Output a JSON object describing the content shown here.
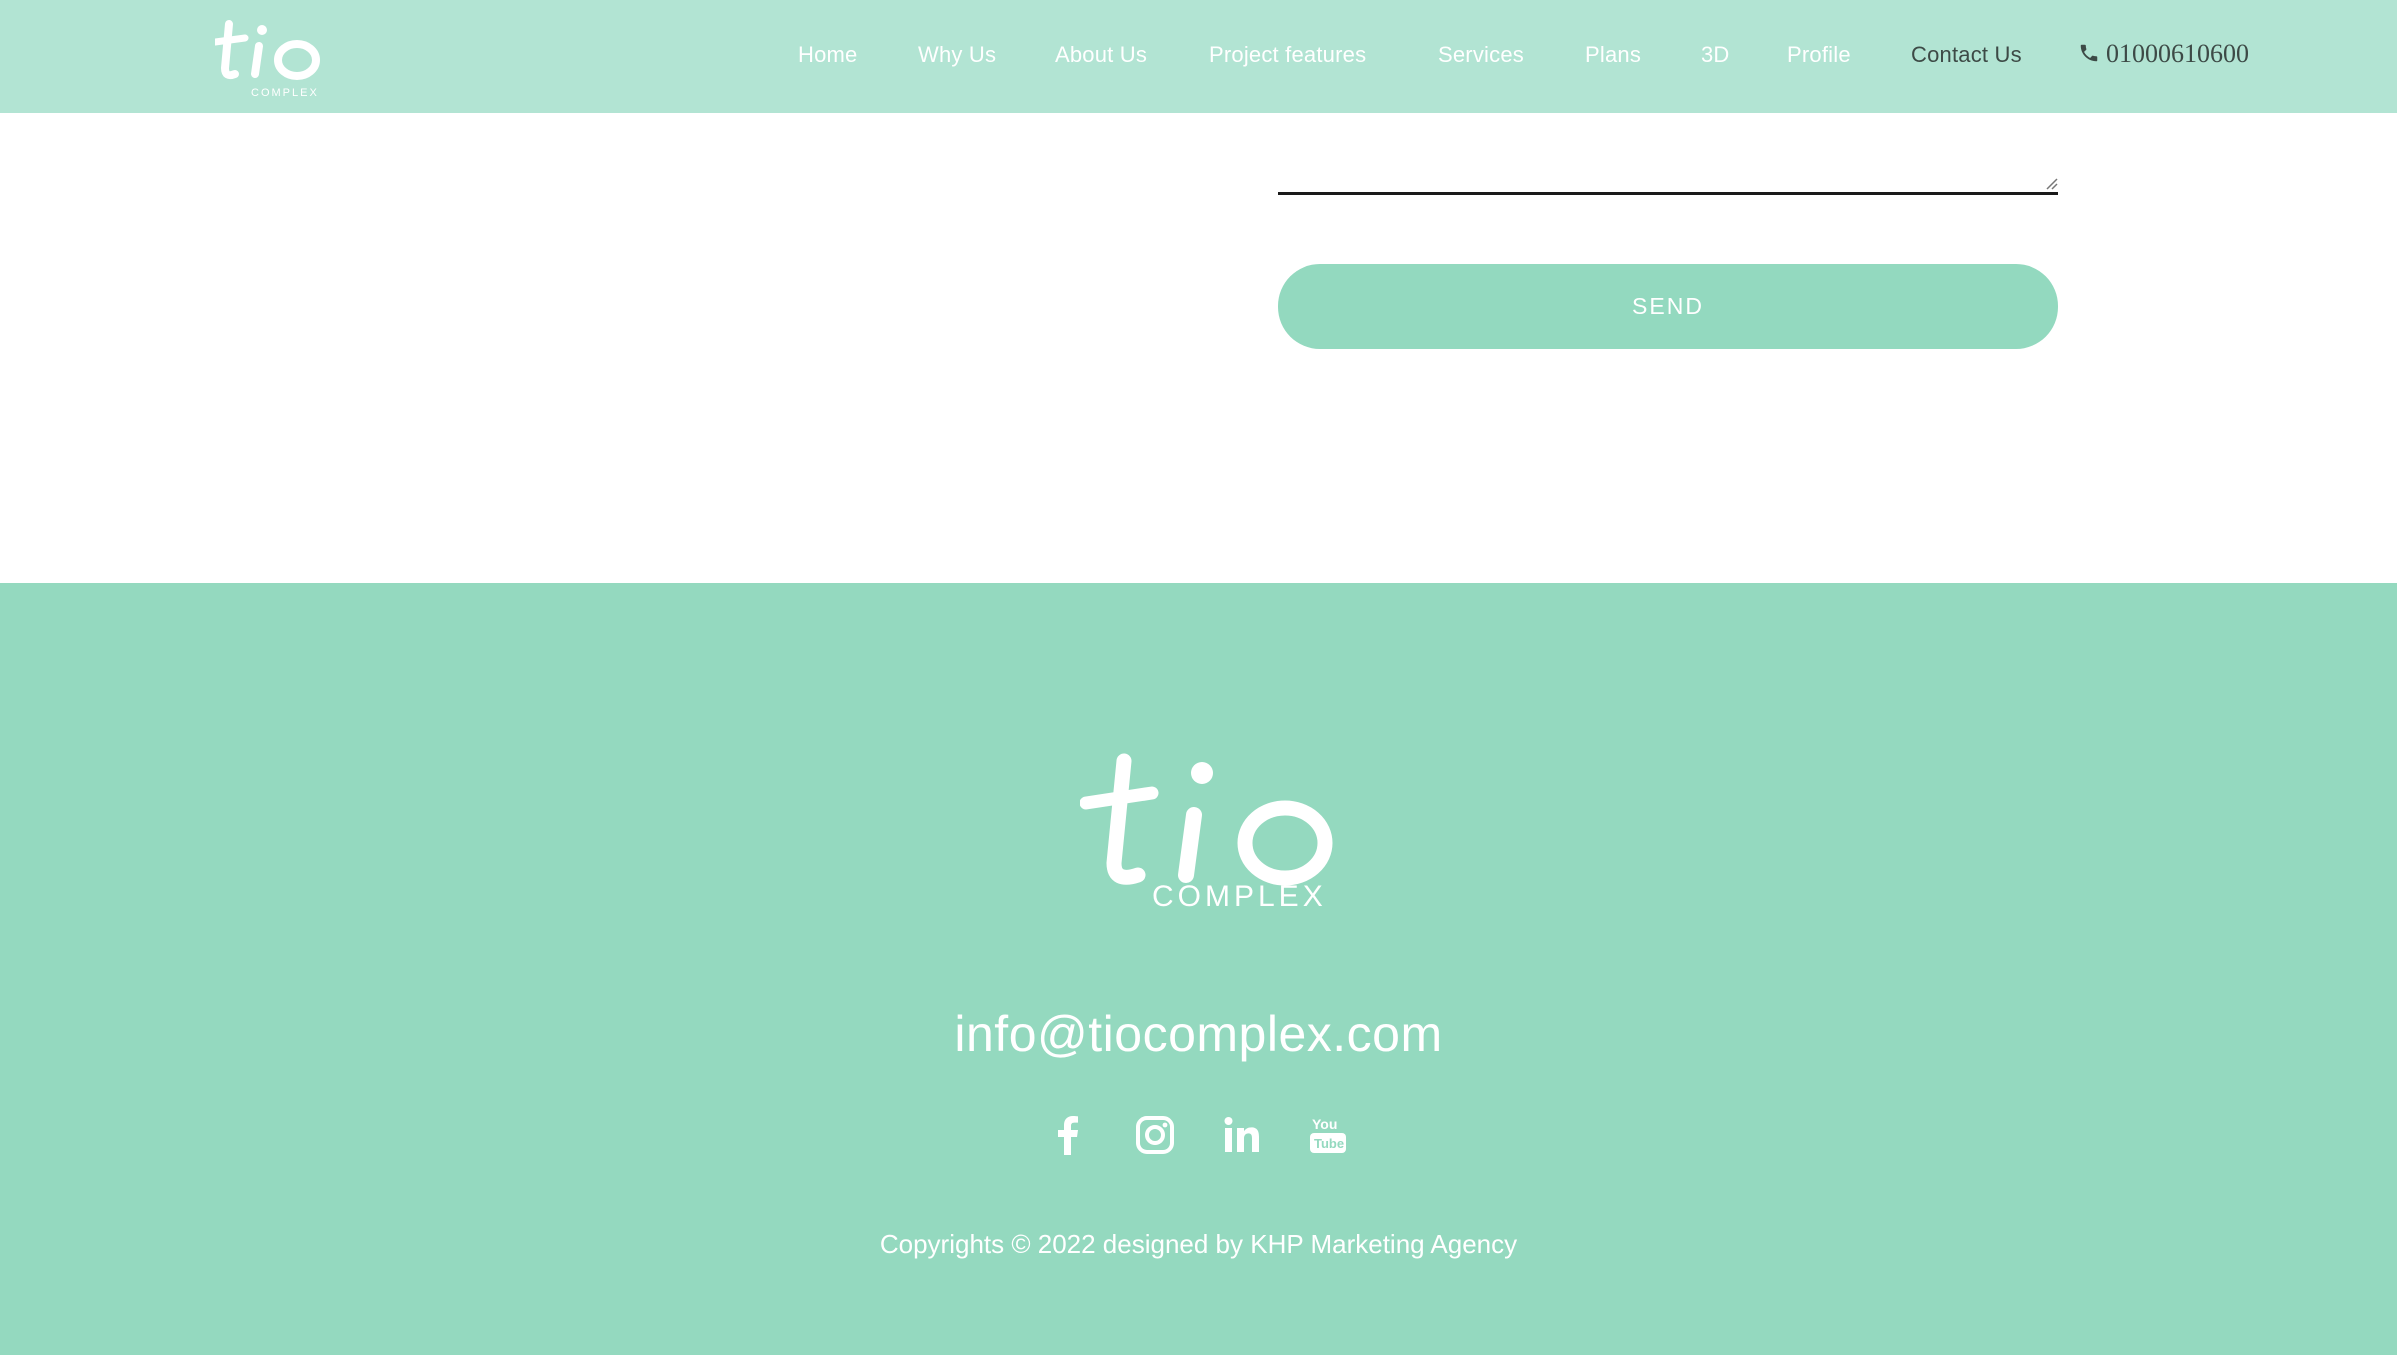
{
  "header": {
    "brand_logo": "tio COMPLEX logo",
    "nav": [
      {
        "label": "Home"
      },
      {
        "label": "Why Us"
      },
      {
        "label": "About Us"
      },
      {
        "label": "Project features"
      },
      {
        "label": "Services"
      },
      {
        "label": "Plans"
      },
      {
        "label": "3D"
      },
      {
        "label": "Profile"
      },
      {
        "label": "Contact Us"
      }
    ],
    "phone": "01000610600",
    "phone_icon": "phone-icon"
  },
  "form": {
    "message_value": "",
    "send_label": "SEND"
  },
  "footer": {
    "logo_word": "tio",
    "logo_sub": "COMPLEX",
    "email": "info@tiocomplex.com",
    "social": [
      "facebook-icon",
      "instagram-icon",
      "linkedin-icon",
      "youtube-icon"
    ],
    "copyright": "Copyrights © 2022 designed by KHP Marketing Agency"
  },
  "colors": {
    "header_bg": "#b2e4d3",
    "accent": "#94d9bf",
    "active_nav": "#3d4a46"
  }
}
